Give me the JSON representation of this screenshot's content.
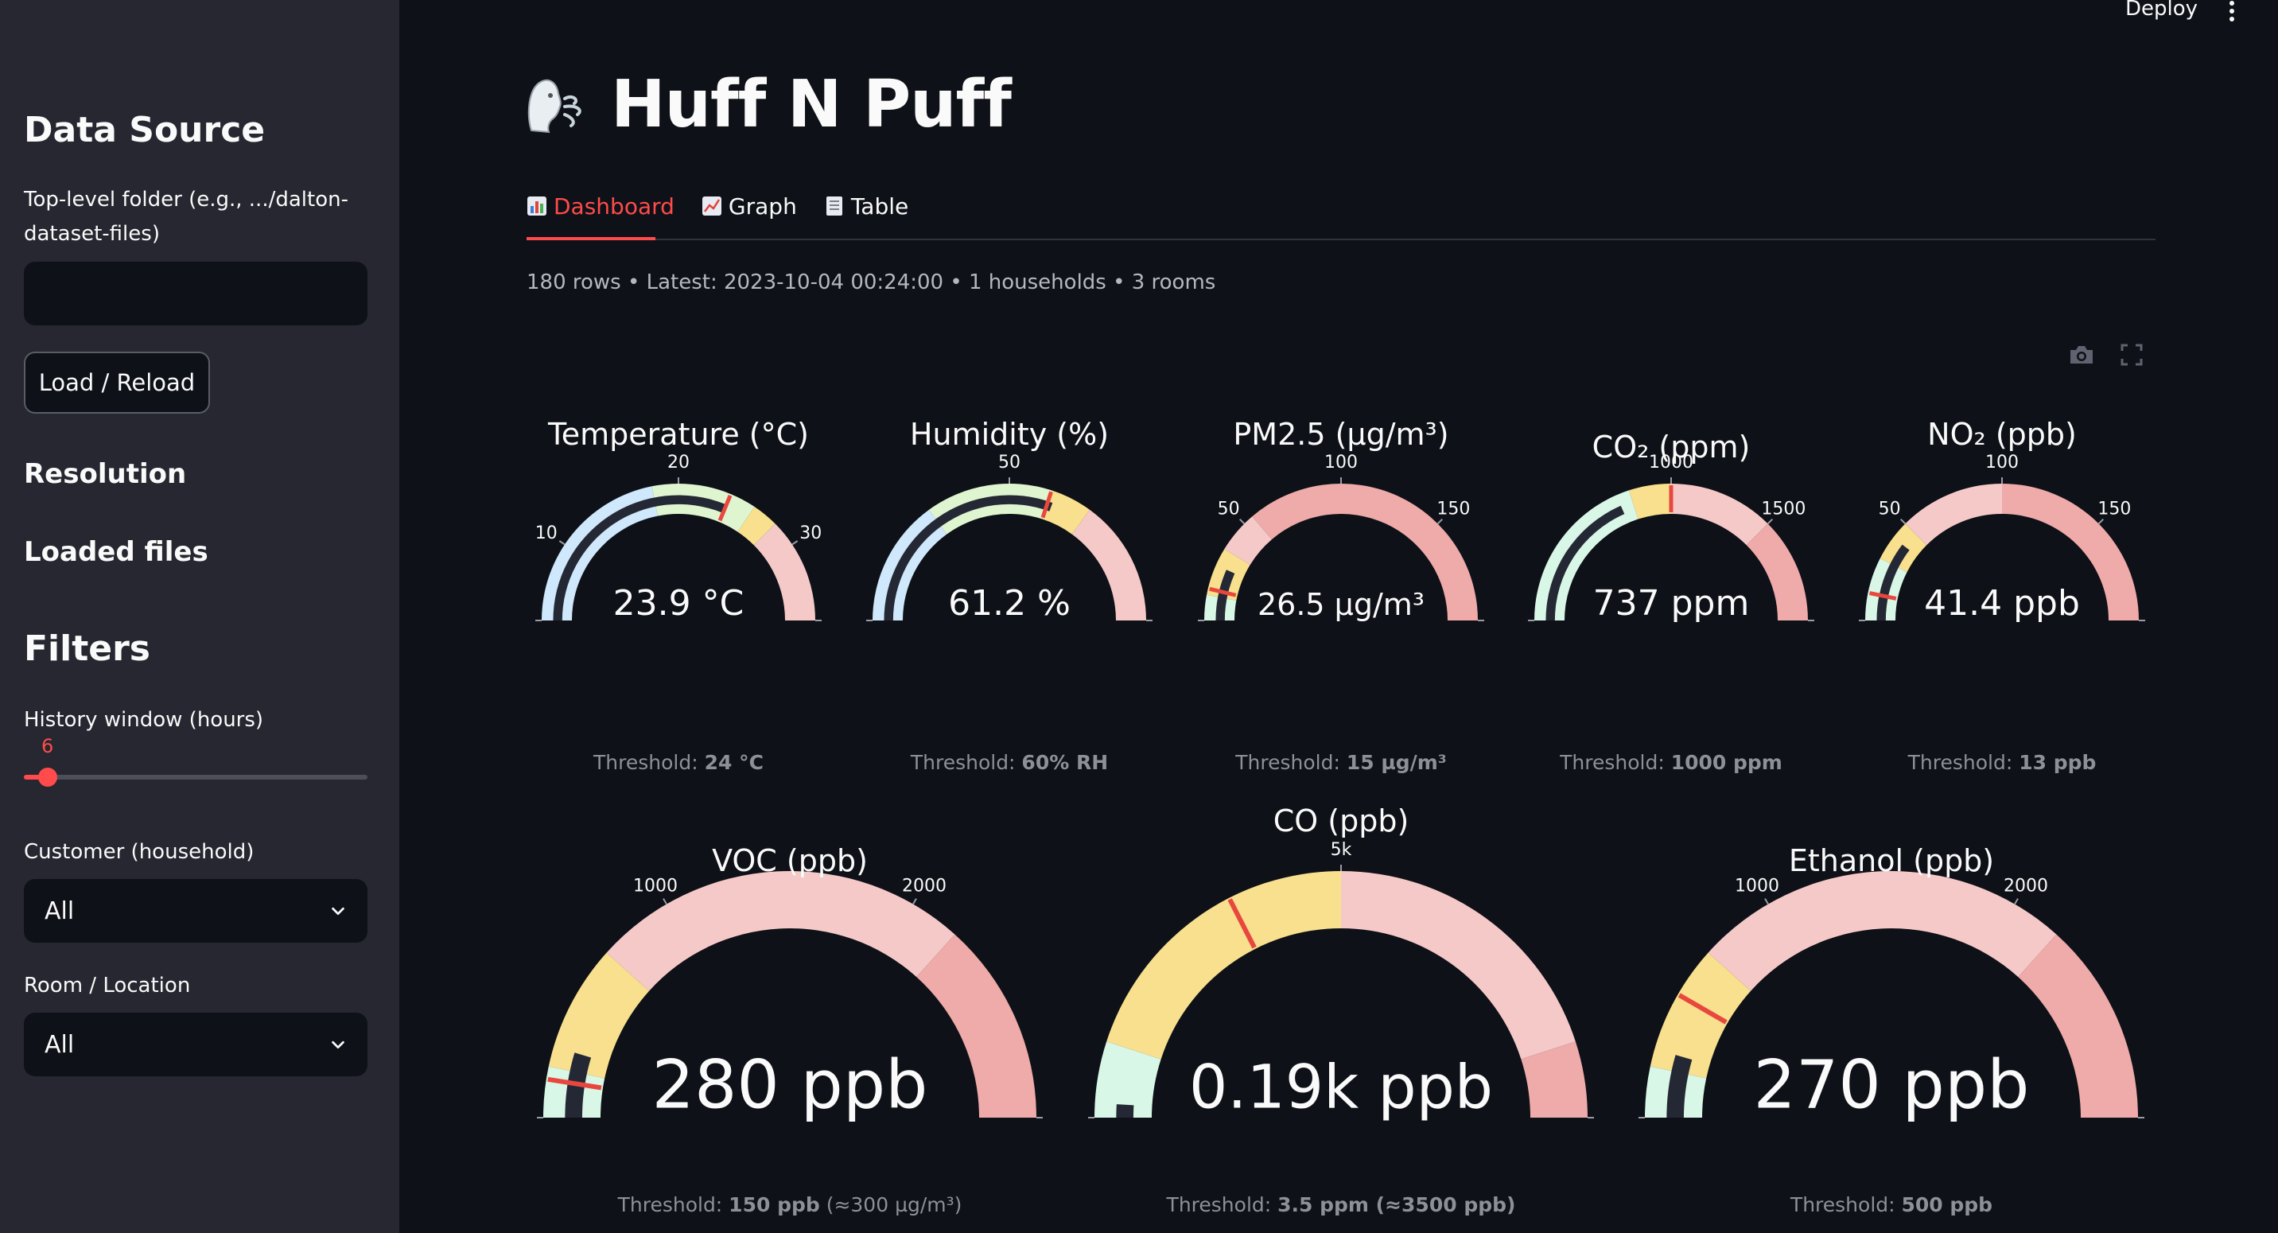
{
  "header": {
    "deploy_label": "Deploy",
    "app_title": "Huff N Puff"
  },
  "sidebar": {
    "data_source_heading": "Data Source",
    "folder_label": "Top-level folder (e.g., .../dalton-dataset-files)",
    "folder_label_line1": "Top-level folder (e.g., .../dalton-",
    "folder_label_line2": "dataset-files)",
    "folder_value": "",
    "load_button": "Load / Reload",
    "resolution_heading": "Resolution",
    "loaded_files_heading": "Loaded files",
    "filters_heading": "Filters",
    "history_label": "History window (hours)",
    "history_value": "6",
    "history_fraction": 0.03,
    "customer_label": "Customer (household)",
    "customer_value": "All",
    "room_label": "Room / Location",
    "room_value": "All"
  },
  "tabs": [
    {
      "label": "Dashboard",
      "icon": "bar-chart-icon",
      "active": true
    },
    {
      "label": "Graph",
      "icon": "line-chart-icon",
      "active": false
    },
    {
      "label": "Table",
      "icon": "table-icon",
      "active": false
    }
  ],
  "summary": "180 rows • Latest: 2023-10-04 00:24:00 • 1 households • 3 rooms",
  "colors": {
    "accent": "#ff4b4b",
    "blue": "#cfe8fb",
    "green": "#dff5d0",
    "mint": "#d9f7e6",
    "yellow": "#f8e08e",
    "pink": "#f6c9c9",
    "red": "#efaaaa",
    "needle": "#e8473e",
    "bar": "#242834"
  },
  "gauges": [
    {
      "title": "Temperature (°C)",
      "display": "23.9 °C",
      "value": 23.9,
      "min": 4,
      "max": 36,
      "ticks": [
        {
          "v": 10,
          "t": "10"
        },
        {
          "v": 20,
          "t": "20"
        },
        {
          "v": 30,
          "t": "30"
        }
      ],
      "bands": [
        {
          "from": 4,
          "to": 18,
          "color": "blue"
        },
        {
          "from": 18,
          "to": 26,
          "color": "green"
        },
        {
          "from": 26,
          "to": 28,
          "color": "yellow"
        },
        {
          "from": 28,
          "to": 36,
          "color": "pink"
        }
      ],
      "threshold": 24,
      "threshold_prefix": "Threshold: ",
      "threshold_value": "24 °C",
      "threshold_suffix": ""
    },
    {
      "title": "Humidity (%)",
      "display": "61.2 %",
      "value": 61.2,
      "min": 0,
      "max": 100,
      "ticks": [
        {
          "v": 50,
          "t": "50"
        }
      ],
      "bands": [
        {
          "from": 0,
          "to": 30,
          "color": "blue"
        },
        {
          "from": 30,
          "to": 60,
          "color": "green"
        },
        {
          "from": 60,
          "to": 70,
          "color": "yellow"
        },
        {
          "from": 70,
          "to": 100,
          "color": "pink"
        }
      ],
      "threshold": 60,
      "threshold_prefix": "Threshold: ",
      "threshold_value": "60% RH",
      "threshold_suffix": ""
    },
    {
      "title": "PM2.5 (µg/m³)",
      "display": "26.5 µg/m³",
      "value": 26.5,
      "min": 0,
      "max": 200,
      "ticks": [
        {
          "v": 50,
          "t": "50"
        },
        {
          "v": 100,
          "t": "100"
        },
        {
          "v": 150,
          "t": "150"
        }
      ],
      "bands": [
        {
          "from": 0,
          "to": 12,
          "color": "mint"
        },
        {
          "from": 12,
          "to": 35,
          "color": "yellow"
        },
        {
          "from": 35,
          "to": 55,
          "color": "pink"
        },
        {
          "from": 55,
          "to": 200,
          "color": "red"
        }
      ],
      "threshold": 15,
      "threshold_prefix": "Threshold: ",
      "threshold_value": "15 µg/m³",
      "threshold_suffix": ""
    },
    {
      "title": "CO₂ (ppm)",
      "display": "737 ppm",
      "value": 737,
      "min": 0,
      "max": 2000,
      "ticks": [
        {
          "v": 1000,
          "t": "1000"
        },
        {
          "v": 1500,
          "t": "1500"
        }
      ],
      "bands": [
        {
          "from": 0,
          "to": 800,
          "color": "mint"
        },
        {
          "from": 800,
          "to": 1000,
          "color": "yellow"
        },
        {
          "from": 1000,
          "to": 1500,
          "color": "pink"
        },
        {
          "from": 1500,
          "to": 2000,
          "color": "red"
        }
      ],
      "threshold": 1000,
      "threshold_prefix": "Threshold: ",
      "threshold_value": "1000 ppm",
      "threshold_suffix": ""
    },
    {
      "title": "NO₂ (ppb)",
      "display": "41.4 ppb",
      "value": 41.4,
      "min": 0,
      "max": 200,
      "ticks": [
        {
          "v": 50,
          "t": "50"
        },
        {
          "v": 100,
          "t": "100"
        },
        {
          "v": 150,
          "t": "150"
        }
      ],
      "bands": [
        {
          "from": 0,
          "to": 30,
          "color": "mint"
        },
        {
          "from": 30,
          "to": 50,
          "color": "yellow"
        },
        {
          "from": 50,
          "to": 100,
          "color": "pink"
        },
        {
          "from": 100,
          "to": 200,
          "color": "red"
        }
      ],
      "threshold": 13,
      "threshold_prefix": "Threshold: ",
      "threshold_value": "13 ppb",
      "threshold_suffix": ""
    },
    {
      "title": "VOC (ppb)",
      "display": "280 ppb",
      "value": 280,
      "min": 0,
      "max": 3000,
      "ticks": [
        {
          "v": 1000,
          "t": "1000"
        },
        {
          "v": 2000,
          "t": "2000"
        }
      ],
      "bands": [
        {
          "from": 0,
          "to": 200,
          "color": "mint"
        },
        {
          "from": 200,
          "to": 700,
          "color": "yellow"
        },
        {
          "from": 700,
          "to": 2200,
          "color": "pink"
        },
        {
          "from": 2200,
          "to": 3000,
          "color": "red"
        }
      ],
      "threshold": 150,
      "threshold_prefix": "Threshold: ",
      "threshold_value": "150 ppb",
      "threshold_suffix": " (≈300 µg/m³)"
    },
    {
      "title": "CO (ppb)",
      "display": "0.19k ppb",
      "value": 190,
      "min": 0,
      "max": 10000,
      "ticks": [
        {
          "v": 5000,
          "t": "5k"
        }
      ],
      "bands": [
        {
          "from": 0,
          "to": 1000,
          "color": "mint"
        },
        {
          "from": 1000,
          "to": 5000,
          "color": "yellow"
        },
        {
          "from": 5000,
          "to": 9000,
          "color": "pink"
        },
        {
          "from": 9000,
          "to": 10000,
          "color": "red"
        }
      ],
      "threshold": 3500,
      "threshold_prefix": "Threshold: ",
      "threshold_value": "3.5 ppm (≈3500 ppb)",
      "threshold_suffix": ""
    },
    {
      "title": "Ethanol (ppb)",
      "display": "270 ppb",
      "value": 270,
      "min": 0,
      "max": 3000,
      "ticks": [
        {
          "v": 1000,
          "t": "1000"
        },
        {
          "v": 2000,
          "t": "2000"
        }
      ],
      "bands": [
        {
          "from": 0,
          "to": 200,
          "color": "mint"
        },
        {
          "from": 200,
          "to": 700,
          "color": "yellow"
        },
        {
          "from": 700,
          "to": 2200,
          "color": "pink"
        },
        {
          "from": 2200,
          "to": 3000,
          "color": "red"
        }
      ],
      "threshold": 500,
      "threshold_prefix": "Threshold: ",
      "threshold_value": "500 ppb",
      "threshold_suffix": ""
    }
  ]
}
